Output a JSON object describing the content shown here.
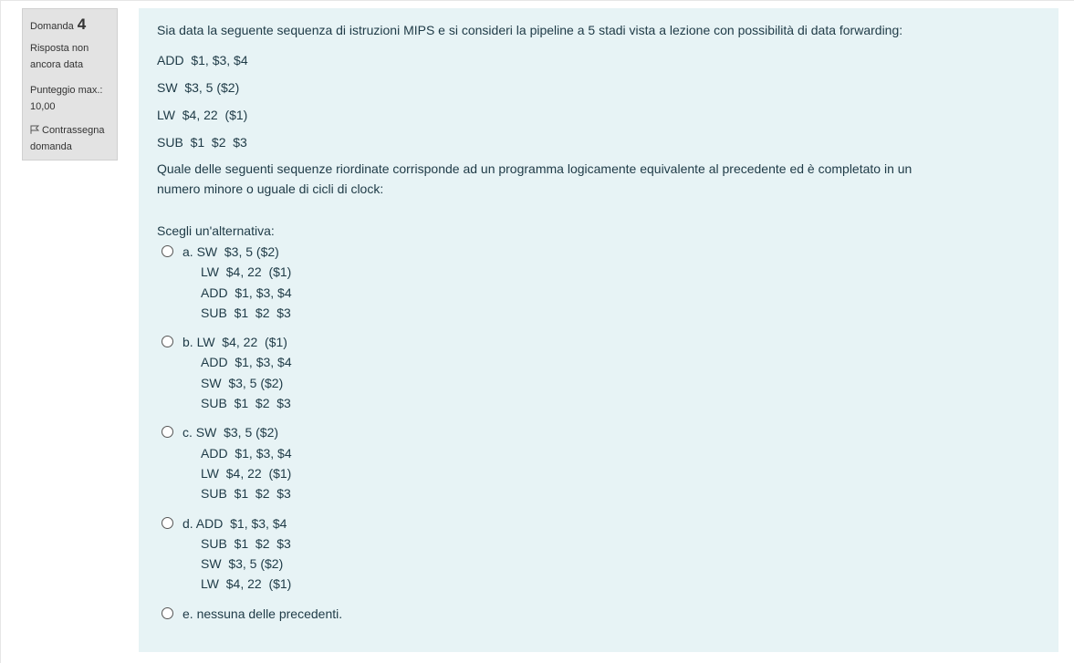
{
  "info": {
    "question_label": "Domanda",
    "question_number": "4",
    "state_line1": "Risposta non",
    "state_line2": "ancora data",
    "grade_line1": "Punteggio max.:",
    "grade_line2": "10,00",
    "flag_line1": "Contrassegna",
    "flag_line2": "domanda"
  },
  "question": {
    "intro": "Sia data la seguente sequenza di istruzioni MIPS e si consideri la pipeline a 5 stadi vista a lezione con possibilità di data forwarding:",
    "instructions": [
      "ADD  $1, $3, $4",
      "SW  $3, 5 ($2)",
      "LW  $4, 22  ($1)",
      "SUB  $1  $2  $3"
    ],
    "text_line1": "Quale delle seguenti sequenze riordinate corrisponde ad un programma logicamente equivalente al precedente ed è completato in un",
    "text_line2": "numero minore o uguale di cicli di clock:",
    "prompt": "Scegli un'alternativa:"
  },
  "options": [
    {
      "first": "a. SW  $3, 5 ($2)",
      "rest": [
        "LW  $4, 22  ($1)",
        "ADD  $1, $3, $4",
        "SUB  $1  $2  $3"
      ]
    },
    {
      "first": "b. LW  $4, 22  ($1)",
      "rest": [
        "ADD  $1, $3, $4",
        "SW  $3, 5 ($2)",
        "SUB  $1  $2  $3"
      ]
    },
    {
      "first": "c. SW  $3, 5 ($2)",
      "rest": [
        "ADD  $1, $3, $4",
        "LW  $4, 22  ($1)",
        "SUB  $1  $2  $3"
      ]
    },
    {
      "first": "d. ADD  $1, $3, $4",
      "rest": [
        "SUB  $1  $2  $3",
        "SW  $3, 5 ($2)",
        "LW  $4, 22  ($1)"
      ]
    },
    {
      "first": "e. nessuna delle precedenti.",
      "rest": []
    }
  ],
  "colors": {
    "info_bg": "#e3e3e3",
    "content_bg": "#e7f3f5",
    "text": "#1e3a46"
  }
}
